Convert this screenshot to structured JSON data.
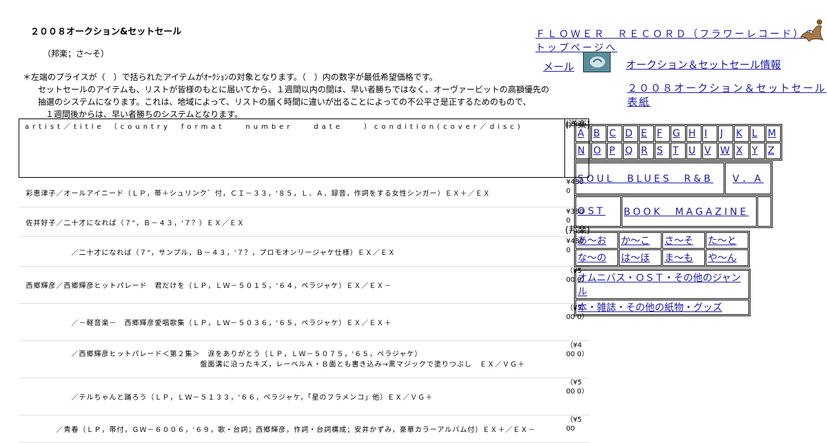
{
  "page_title": "２００８オークション&セットセール",
  "subtitle": "（邦楽；さ～そ）",
  "notes": [
    "＊左端のプライスが（　）で括られたアイテムがｵｰｸｼｮﾝの対象となります。（　）内の数字が最低希望価格です。",
    "セットセールのアイテムも、リストが皆様のもとに届いてから、１週間以内の間は、早い者勝ちではなく、オーヴァービットの高額優先の",
    "抽選のシステムになります。これは、地域によって、リストの届く時間に違いが出ることによっての不公平さ是正するためのもので、",
    "１週間後からは、早い者勝ちのシステムとなります。"
  ],
  "header": {
    "artist_col": "artist／title （country　format　　number　　date　　）condition(cover／disc)",
    "price_col": "price"
  },
  "rows": [
    {
      "text": "彩恵津子／オールアイニード（ＬＰ，帯＋シュリンク゛付，ＣＩ－３３，'８５，Ｌ．Ａ．録音，作詞をする女性シンガー）ＥＸ＋／ＥＸ",
      "price": "¥480 0"
    },
    {
      "text": "佐井好子／二十才になれば（７\"，Ｂ－４３，'７？）ＥＸ／ＥＸ",
      "price": "¥380 0"
    },
    {
      "text": "　　　　　　／二十才になれば（７\"，サンプル，Ｂ－４３，'７？，プロモオンリージャケ仕様）ＥＸ／ＥＸ",
      "price": "¥480 0"
    },
    {
      "text": "西郷輝彦／西郷輝彦ヒットパレード　君だけを（ＬＰ，ＬＷ－５０１５，'６４，ペラジャケ）ＥＸ／ＥＸ－",
      "price": "（¥5 00 0）"
    },
    {
      "text": "　　　　　　／－軽音楽－　西郷輝彦愛唱歌集（ＬＰ，ＬＷ－５０３６，'６５，ペラジャケ）ＥＸ／ＥＸ＋",
      "price": "（¥5 00 0）"
    },
    {
      "text": "　　　　　　／西郷輝彦ヒットパレード＜第２集＞　涙をありがとう（ＬＰ，ＬＷ－５０７５，'６５，ペラジャケ）\n　　　　　　　　　　　　　　　　　　　　　　　盤面溝に沿ったキズ，レーベルＡ・Ｂ面とも書き込み→黒マジックで塗りつぶし　ＥＸ／ＶＧ＋",
      "price": "（¥4 00 0）"
    },
    {
      "text": "　　　　　　／テルちゃんと踊ろう（ＬＰ，ＬＷ－５１３３，'６６，ペラジャケ，「星のフラメンコ」他）ＥＸ／ＶＧ＋",
      "price": "（¥5 00 0）"
    },
    {
      "text": "　　　　／青春（ＬＰ，帯付，ＧＷ－６００６，'６９，歌・台詞；西郷輝彦，作詞・台詞構成；安井かずみ，豪華カラーアルバム付）ＥＸ＋／ＥＸ－",
      "price": "（¥5 00"
    }
  ],
  "site": {
    "title": "ＦＬＯＷＥＲ　ＲＥＣＯＲＤ（フラワーレコード）のトップページへ",
    "mail": "メール",
    "auction_info": "オークション＆セットセール情報",
    "cover": "２００８オークション＆セットセール表紙"
  },
  "western_label": "(洋楽)",
  "japanese_label": "(邦楽)",
  "letters_row1": [
    "A",
    "B",
    "C",
    "D",
    "E",
    "F",
    "G",
    "H",
    "I",
    "J",
    "K",
    "L",
    "M"
  ],
  "letters_row2": [
    "N",
    "O",
    "P",
    "Q",
    "R",
    "S",
    "T",
    "U",
    "V",
    "W",
    "X",
    "Y",
    "Z"
  ],
  "western_extra": {
    "soul": "SOUL　BLUES　R&B",
    "va": "V．A",
    "ost": "OST",
    "book": "BOOK　MAGAZINE"
  },
  "kana": [
    "あ～お",
    "か～こ",
    "さ～そ",
    "た～と",
    "な～の",
    "は～ほ",
    "ま～も",
    "や～ん"
  ],
  "japanese_extra": {
    "omnibus": "オムニバス・ＯＳＴ・その他のジャンル",
    "books": "本・雑誌・その他の紙物・グッズ"
  }
}
